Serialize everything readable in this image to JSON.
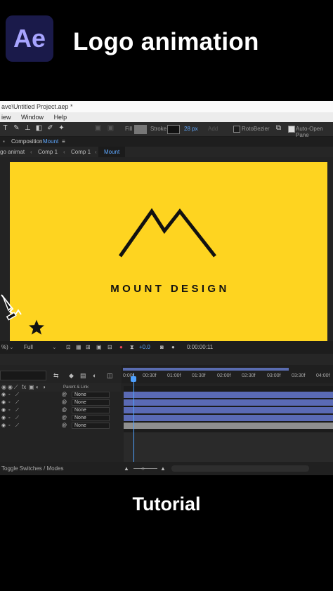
{
  "header": {
    "app_logo": "Ae",
    "headline": "Logo animation"
  },
  "window": {
    "title": "ave\\Untitled Project.aep *",
    "menu": [
      "iew",
      "Window",
      "Help"
    ]
  },
  "toolbar": {
    "fill_label": "Fill",
    "stroke_label": "Stroke",
    "stroke_width": "28 px",
    "add_label": "Add",
    "rotobezier_label": "RotoBezier",
    "autoopen_label": "Auto-Open Pane"
  },
  "composition_panel": {
    "label": "Composition",
    "name": "Mount",
    "menu_icon": "≡"
  },
  "tabs": [
    "go animat",
    "Comp 1",
    "Comp 1",
    "Mount"
  ],
  "artwork": {
    "brand_text": "MOUNT DESIGN",
    "logo_color": "#111111",
    "background": "#fed420"
  },
  "viewer_bar": {
    "zoom": "%)",
    "resolution": "Full",
    "exposure": "+0.0",
    "timecode": "0:00:00:11"
  },
  "timeline": {
    "ruler_ticks": [
      "0:00f",
      "00:30f",
      "01:00f",
      "01:30f",
      "02:00f",
      "02:30f",
      "03:00f",
      "03:30f",
      "04:00f"
    ],
    "parent_col_label": "Parent & Link",
    "layers": [
      {
        "parent": "None"
      },
      {
        "parent": "None"
      },
      {
        "parent": "None"
      },
      {
        "parent": "None"
      },
      {
        "parent": "None"
      }
    ],
    "status_text": "Toggle Switches / Modes"
  },
  "footer": {
    "caption": "Tutorial"
  },
  "colors": {
    "accent_blue": "#4ea1ff",
    "layer_bar": "#5a6ab5",
    "ae_purple": "#a7a4ff"
  }
}
